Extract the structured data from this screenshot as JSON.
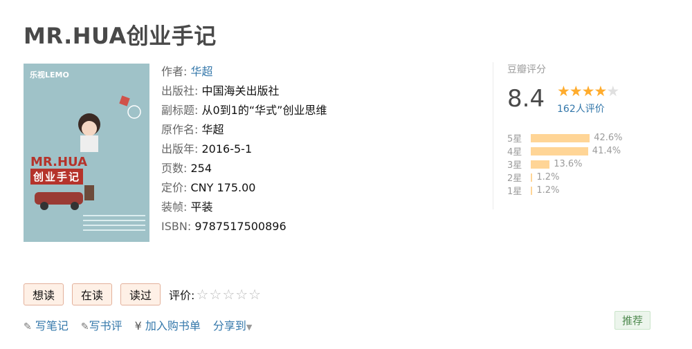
{
  "book": {
    "title": "MR.HUA创业手记",
    "info": [
      {
        "label": "作者:",
        "value": "华超",
        "link": true
      },
      {
        "label": "出版社:",
        "value": "中国海关出版社",
        "link": false
      },
      {
        "label": "副标题:",
        "value": "从0到1的“华式”创业思维",
        "link": false
      },
      {
        "label": "原作名:",
        "value": "华超",
        "link": false
      },
      {
        "label": "出版年:",
        "value": "2016-5-1",
        "link": false
      },
      {
        "label": "页数:",
        "value": "254",
        "link": false
      },
      {
        "label": "定价:",
        "value": "CNY 175.00",
        "link": false
      },
      {
        "label": "装帧:",
        "value": "平装",
        "link": false
      },
      {
        "label": "ISBN:",
        "value": "9787517500896",
        "link": false
      }
    ]
  },
  "cover": {
    "brand": "乐视LEMO",
    "title_en": "MR.HUA",
    "title_cn": "创业手记"
  },
  "rating": {
    "heading": "豆瓣评分",
    "score": "8.4",
    "stars_filled": 4,
    "people": "162人评价",
    "distribution": [
      {
        "label": "5星",
        "percent": "42.6%",
        "value": 42.6
      },
      {
        "label": "4星",
        "percent": "41.4%",
        "value": 41.4
      },
      {
        "label": "3星",
        "percent": "13.6%",
        "value": 13.6
      },
      {
        "label": "2星",
        "percent": "1.2%",
        "value": 1.2
      },
      {
        "label": "1星",
        "percent": "1.2%",
        "value": 1.2
      }
    ]
  },
  "actions": {
    "want": "想读",
    "reading": "在读",
    "read": "读过",
    "rate_label": "评价:"
  },
  "links": {
    "note": "写笔记",
    "review": "写书评",
    "cart": "加入购书单",
    "share": "分享到"
  },
  "recommend": "推荐",
  "colors": {
    "link": "#3377aa",
    "star": "#ffac2d",
    "bar": "#ffd596"
  }
}
